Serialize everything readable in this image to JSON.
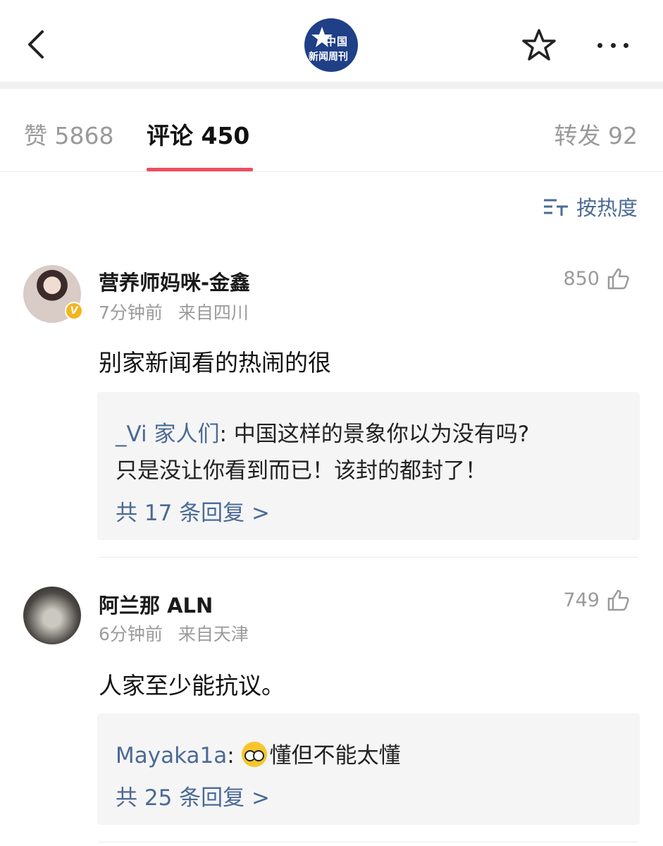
{
  "header": {
    "logo_line1": "中国",
    "logo_line2": "新闻周刊"
  },
  "tabs": {
    "like_label": "赞 5868",
    "comments_label": "评论 450",
    "repost_label": "转发 92"
  },
  "sort": {
    "label": "按热度"
  },
  "comments": [
    {
      "username": "营养师妈咪-金鑫",
      "time": "7分钟前",
      "location": "来自四川",
      "likes": "850",
      "text": "别家新闻看的热闹的很",
      "reply_author": "_Vi 家人们",
      "reply_line1": ": 中国这样的景象你以为没有吗?",
      "reply_line2": "只是没让你看到而已！该封的都封了！",
      "reply_more": "共 17 条回复 >"
    },
    {
      "username": "阿兰那 ALN",
      "time": "6分钟前",
      "location": "来自天津",
      "likes": "749",
      "text": "人家至少能抗议。",
      "reply_author": "Mayaka1a",
      "reply_line1": "懂但不能太懂",
      "reply_more": "共 25 条回复 >"
    }
  ],
  "colors": {
    "accent_link": "#4a6a96",
    "tab_indicator": "#ee4d5f",
    "logo_bg": "#1f3f87"
  }
}
